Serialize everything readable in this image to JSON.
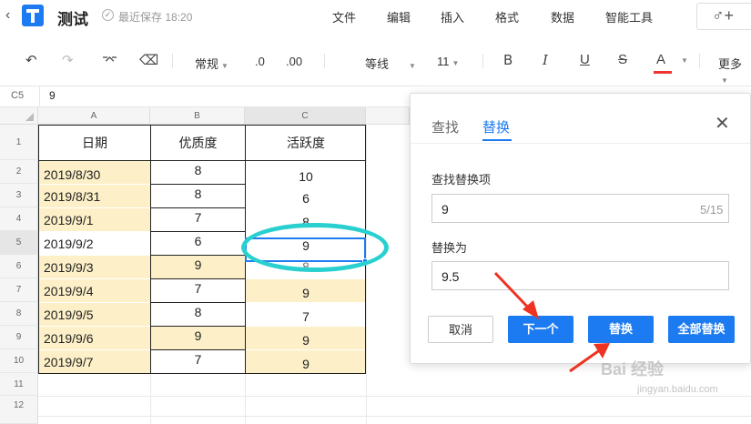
{
  "topbar": {
    "title": "测试",
    "save_status": "最近保存 18:20",
    "menus": [
      "文件",
      "编辑",
      "插入",
      "格式",
      "数据",
      "智能工具"
    ]
  },
  "toolbar": {
    "format": "常规",
    "dec_dec": ".0",
    "dec_inc": ".00",
    "font": "等线",
    "size": "11",
    "more": "更多",
    "accent_color": "#e33333"
  },
  "formula_bar": {
    "cell_ref": "C5",
    "value": "9"
  },
  "sheet": {
    "columns": [
      "A",
      "B",
      "C"
    ],
    "rows": [
      "1",
      "2",
      "3",
      "4",
      "5",
      "6",
      "7",
      "8",
      "9",
      "10",
      "11",
      "12"
    ],
    "header": [
      "日期",
      "优质度",
      "活跃度"
    ],
    "data": [
      [
        "2019/8/30",
        "8",
        "10"
      ],
      [
        "2019/8/31",
        "8",
        "6"
      ],
      [
        "2019/9/1",
        "7",
        "8"
      ],
      [
        "2019/9/2",
        "6",
        "9"
      ],
      [
        "2019/9/3",
        "9",
        "8"
      ],
      [
        "2019/9/4",
        "7",
        "9"
      ],
      [
        "2019/9/5",
        "8",
        "7"
      ],
      [
        "2019/9/6",
        "9",
        "9"
      ],
      [
        "2019/9/7",
        "7",
        "9"
      ]
    ],
    "highlight_color": "#fdf0c8"
  },
  "dialog": {
    "tab_find": "查找",
    "tab_replace": "替换",
    "find_label": "查找替换项",
    "find_value": "9",
    "match_count": "5/15",
    "replace_label": "替换为",
    "replace_value": "9.5",
    "btn_cancel": "取消",
    "btn_next": "下一个",
    "btn_replace": "替换",
    "btn_replace_all": "全部替换",
    "accent_color": "#1c7bf0"
  },
  "watermark": {
    "text": "Bai 经验",
    "sub": "jingyan.baidu.com"
  }
}
